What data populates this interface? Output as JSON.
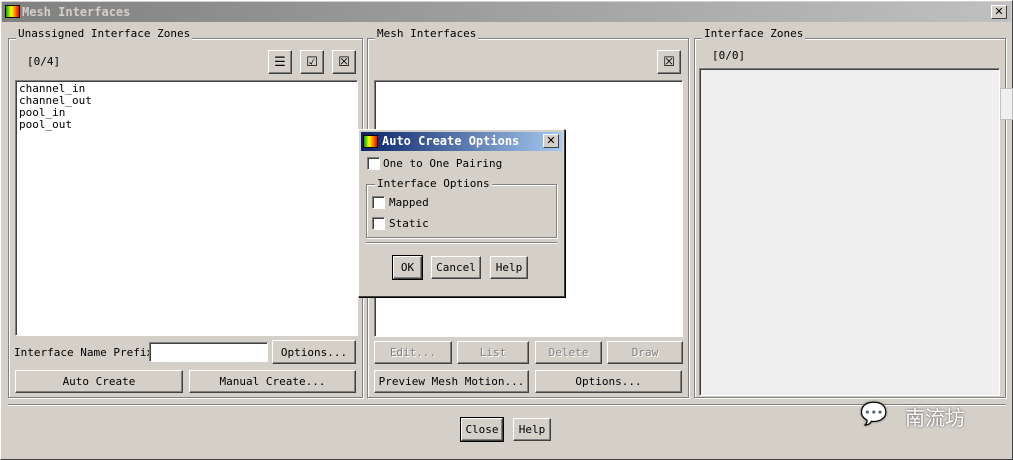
{
  "window": {
    "title": "Mesh Interfaces",
    "close": "✕"
  },
  "unassigned": {
    "title": "Unassigned Interface Zones",
    "count": "[0/4]",
    "items": [
      "channel_in",
      "channel_out",
      "pool_in",
      "pool_out"
    ],
    "prefix_label": "Interface Name Prefix",
    "prefix_value": "",
    "options": "Options...",
    "auto_create": "Auto Create",
    "manual_create": "Manual Create..."
  },
  "mesh": {
    "title": "Mesh Interfaces",
    "edit": "Edit...",
    "list": "List",
    "delete": "Delete",
    "draw": "Draw",
    "preview": "Preview Mesh Motion...",
    "options": "Options..."
  },
  "zones": {
    "title": "Interface Zones",
    "count": "[0/0]"
  },
  "footer": {
    "close": "Close",
    "help": "Help"
  },
  "watermark": "南流坊",
  "dialog": {
    "title": "Auto Create Options",
    "close": "✕",
    "one_to_one": "One to One Pairing",
    "group": "Interface Options",
    "mapped": "Mapped",
    "static": "Static",
    "ok": "OK",
    "cancel": "Cancel",
    "help": "Help"
  }
}
